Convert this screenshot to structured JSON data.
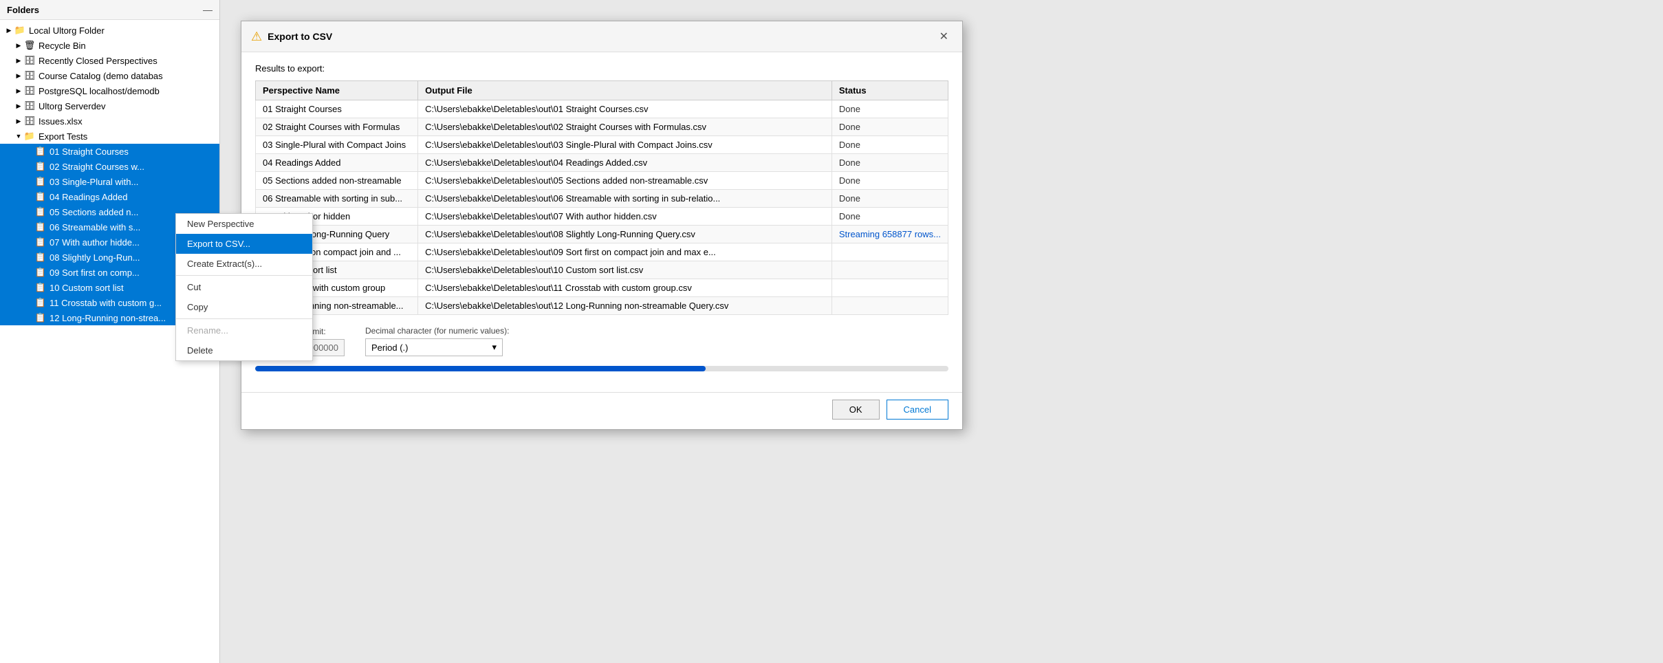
{
  "folders": {
    "header": "Folders",
    "minimize_label": "—",
    "tree": [
      {
        "id": "local-folder",
        "label": "Local Ultorg Folder",
        "icon": "📁",
        "chevron": "▶",
        "indent": 0,
        "expanded": true
      },
      {
        "id": "recycle-bin",
        "label": "Recycle Bin",
        "icon": "🗑",
        "chevron": "▶",
        "indent": 1
      },
      {
        "id": "recently-closed",
        "label": "Recently Closed Perspectives",
        "icon": "🗄",
        "chevron": "▶",
        "indent": 1
      },
      {
        "id": "course-catalog",
        "label": "Course Catalog (demo databas",
        "icon": "🗄",
        "chevron": "▶",
        "indent": 1
      },
      {
        "id": "postgresql",
        "label": "PostgreSQL localhost/demodb",
        "icon": "🗄",
        "chevron": "▶",
        "indent": 1
      },
      {
        "id": "ultorg-server",
        "label": "Ultorg Serverdev",
        "icon": "🗄",
        "chevron": "▶",
        "indent": 1
      },
      {
        "id": "issues-xlsx",
        "label": "Issues.xlsx",
        "icon": "🗄",
        "chevron": "▶",
        "indent": 1
      },
      {
        "id": "export-tests",
        "label": "Export Tests",
        "icon": "📁",
        "chevron": "▼",
        "indent": 1,
        "expanded": true
      },
      {
        "id": "item-01",
        "label": "01 Straight Courses",
        "icon": "📋",
        "chevron": "",
        "indent": 2,
        "selected": true
      },
      {
        "id": "item-02",
        "label": "02 Straight Courses w...",
        "icon": "📋",
        "chevron": "",
        "indent": 2,
        "selected": true
      },
      {
        "id": "item-03",
        "label": "03 Single-Plural with...",
        "icon": "📋",
        "chevron": "",
        "indent": 2,
        "selected": true
      },
      {
        "id": "item-04",
        "label": "04 Readings Added",
        "icon": "📋",
        "chevron": "",
        "indent": 2,
        "selected": true
      },
      {
        "id": "item-05",
        "label": "05 Sections added n...",
        "icon": "📋",
        "chevron": "",
        "indent": 2,
        "selected": true
      },
      {
        "id": "item-06",
        "label": "06 Streamable with s...",
        "icon": "📋",
        "chevron": "",
        "indent": 2,
        "selected": true
      },
      {
        "id": "item-07",
        "label": "07 With author hidde...",
        "icon": "📋",
        "chevron": "",
        "indent": 2,
        "selected": true
      },
      {
        "id": "item-08",
        "label": "08 Slightly Long-Run...",
        "icon": "📋",
        "chevron": "",
        "indent": 2,
        "selected": true
      },
      {
        "id": "item-09",
        "label": "09 Sort first on comp...",
        "icon": "📋",
        "chevron": "",
        "indent": 2,
        "selected": true
      },
      {
        "id": "item-10",
        "label": "10 Custom sort list",
        "icon": "📋",
        "chevron": "",
        "indent": 2,
        "selected": true
      },
      {
        "id": "item-11",
        "label": "11 Crosstab with custom g...",
        "icon": "📋",
        "chevron": "",
        "indent": 2,
        "selected": true
      },
      {
        "id": "item-12",
        "label": "12 Long-Running non-strea...",
        "icon": "📋",
        "chevron": "",
        "indent": 2,
        "selected": true
      }
    ]
  },
  "context_menu": {
    "items": [
      {
        "id": "new-perspective",
        "label": "New Perspective",
        "highlighted": false,
        "disabled": false
      },
      {
        "id": "export-csv",
        "label": "Export to CSV...",
        "highlighted": true,
        "disabled": false
      },
      {
        "id": "create-extracts",
        "label": "Create Extract(s)...",
        "highlighted": false,
        "disabled": false
      },
      {
        "id": "separator1",
        "label": "",
        "separator": true
      },
      {
        "id": "cut",
        "label": "Cut",
        "highlighted": false,
        "disabled": false
      },
      {
        "id": "copy",
        "label": "Copy",
        "highlighted": false,
        "disabled": false
      },
      {
        "id": "separator2",
        "label": "",
        "separator": true
      },
      {
        "id": "rename",
        "label": "Rename...",
        "highlighted": false,
        "disabled": true
      },
      {
        "id": "delete",
        "label": "Delete",
        "highlighted": false,
        "disabled": false
      }
    ]
  },
  "dialog": {
    "title": "Export to CSV",
    "results_label": "Results to export:",
    "close_label": "✕",
    "warning_icon": "⚠",
    "table": {
      "headers": [
        "Perspective Name",
        "Output File",
        "Status"
      ],
      "rows": [
        {
          "perspective": "01 Straight Courses",
          "output": "C:\\Users\\ebakke\\Deletables\\out\\01 Straight Courses.csv",
          "status": "Done",
          "status_type": "done"
        },
        {
          "perspective": "02 Straight Courses with Formulas",
          "output": "C:\\Users\\ebakke\\Deletables\\out\\02 Straight Courses with Formulas.csv",
          "status": "Done",
          "status_type": "done"
        },
        {
          "perspective": "03 Single-Plural with Compact Joins",
          "output": "C:\\Users\\ebakke\\Deletables\\out\\03 Single-Plural with Compact Joins.csv",
          "status": "Done",
          "status_type": "done"
        },
        {
          "perspective": "04 Readings Added",
          "output": "C:\\Users\\ebakke\\Deletables\\out\\04 Readings Added.csv",
          "status": "Done",
          "status_type": "done"
        },
        {
          "perspective": "05 Sections added non-streamable",
          "output": "C:\\Users\\ebakke\\Deletables\\out\\05 Sections added non-streamable.csv",
          "status": "Done",
          "status_type": "done"
        },
        {
          "perspective": "06 Streamable with sorting in sub...",
          "output": "C:\\Users\\ebakke\\Deletables\\out\\06 Streamable with sorting in sub-relatio...",
          "status": "Done",
          "status_type": "done"
        },
        {
          "perspective": "07 With author hidden",
          "output": "C:\\Users\\ebakke\\Deletables\\out\\07 With author hidden.csv",
          "status": "Done",
          "status_type": "done"
        },
        {
          "perspective": "08 Slightly Long-Running Query",
          "output": "C:\\Users\\ebakke\\Deletables\\out\\08 Slightly Long-Running Query.csv",
          "status": "Streaming 658877 rows...",
          "status_type": "streaming"
        },
        {
          "perspective": "09 Sort first on compact join and ...",
          "output": "C:\\Users\\ebakke\\Deletables\\out\\09 Sort first on compact join and max e...",
          "status": "",
          "status_type": "done"
        },
        {
          "perspective": "10 Custom sort list",
          "output": "C:\\Users\\ebakke\\Deletables\\out\\10 Custom sort list.csv",
          "status": "",
          "status_type": "done"
        },
        {
          "perspective": "11 Crosstab with custom group",
          "output": "C:\\Users\\ebakke\\Deletables\\out\\11 Crosstab with custom group.csv",
          "status": "",
          "status_type": "done"
        },
        {
          "perspective": "12 Long-Running non-streamable...",
          "output": "C:\\Users\\ebakke\\Deletables\\out\\12 Long-Running non-streamable Query.csv",
          "status": "",
          "status_type": "done"
        }
      ]
    },
    "options": {
      "max_row_label": "Maximum row limit:",
      "max_row_value": "1000000",
      "decimal_label": "Decimal character (for numeric values):",
      "decimal_value": "Period (.)",
      "decimal_chevron": "▾"
    },
    "progress": {
      "percent": 65
    },
    "footer": {
      "ok_label": "OK",
      "cancel_label": "Cancel"
    }
  }
}
